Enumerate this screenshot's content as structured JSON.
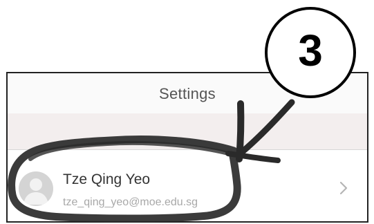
{
  "header": {
    "title": "Settings"
  },
  "profile": {
    "name": "Tze Qing Yeo",
    "email": "tze_qing_yeo@moe.edu.sg",
    "avatar_icon": "person-silhouette",
    "chevron_icon": "chevron-right"
  },
  "annotation": {
    "step_number": "3",
    "ink_color": "#2a2a2a"
  }
}
